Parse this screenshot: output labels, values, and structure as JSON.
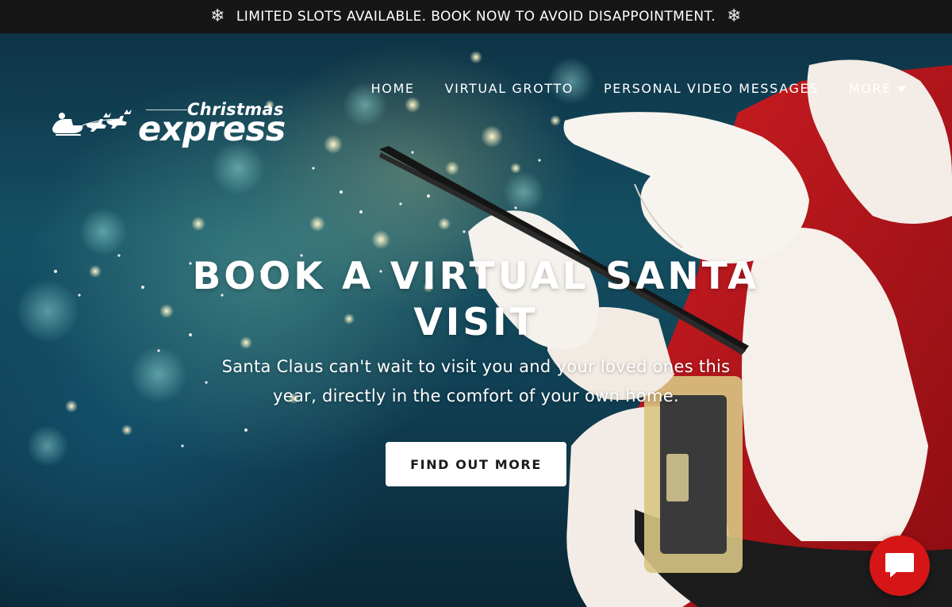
{
  "announcement": {
    "text": "LIMITED SLOTS AVAILABLE. BOOK NOW TO AVOID DISAPPOINTMENT.",
    "icon": "snowflake-icon"
  },
  "logo": {
    "line1": "Christmas",
    "line2": "express",
    "icon": "sleigh-reindeer-icon"
  },
  "nav": {
    "items": [
      "HOME",
      "VIRTUAL GROTTO",
      "PERSONAL VIDEO MESSAGES"
    ],
    "more_label": "MORE"
  },
  "hero": {
    "headline": "BOOK A VIRTUAL SANTA VISIT",
    "subtext": "Santa Claus can't wait to visit you and your loved ones this year, directly in the comfort of your own home.",
    "cta_label": "FIND OUT MORE"
  },
  "chat": {
    "icon": "chat-bubble-icon",
    "color": "#d61616"
  },
  "colors": {
    "announcement_bg": "#161616",
    "santa_red": "#c4161c",
    "cta_bg": "#ffffff"
  }
}
